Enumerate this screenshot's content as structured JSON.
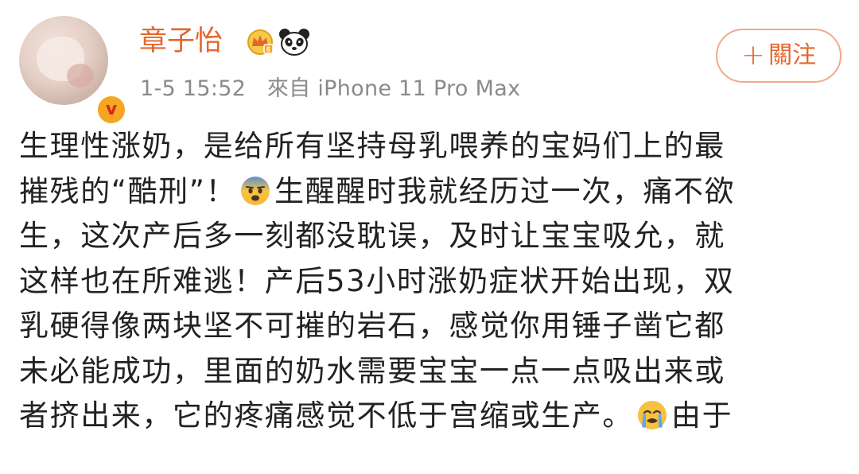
{
  "post": {
    "author": {
      "name": "章子怡",
      "verified_mark": "v",
      "avatar": "avatar-photo",
      "badges": [
        "crown-badge-icon",
        "panda-icon"
      ]
    },
    "timestamp": "1-5 15:52",
    "source": "來自 iPhone 11 Pro Max",
    "follow_button": {
      "plus": "+",
      "label": "關注"
    },
    "lines": [
      "生理性涨奶，是给所有坚持母乳喂养的宝妈们上的最",
      "摧残的“酷刑”！",
      "生醒醒时我就经历过一次，痛不欲",
      "生，这次产后多一刻都没耽误，及时让宝宝吸允，就",
      "这样也在所难逃！产后53小时涨奶症状开始出现，双",
      "乳硬得像两块坚不可摧的岩石，感觉你用锤子凿它都",
      "未必能成功，里面的奶水需要宝宝一点一点吸出来或",
      "者挤出来，它的疼痛感觉不低于宫缩或生产。",
      "由于"
    ],
    "emojis": [
      "fearful-face-emoji",
      "crying-face-emoji"
    ],
    "colors": {
      "username": "#e5672d",
      "meta": "#8a8a8a",
      "follow_border": "#f0a98c",
      "text": "#222222"
    }
  }
}
